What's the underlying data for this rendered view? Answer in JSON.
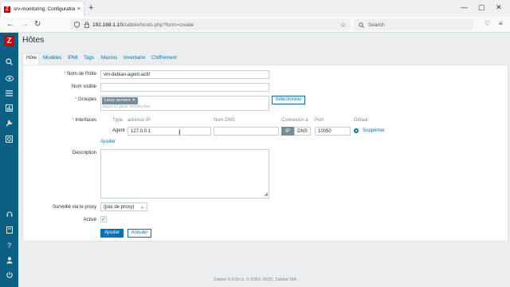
{
  "browser": {
    "tab_title": "srv-monitoring: Configuration",
    "tab_close": "×",
    "new_tab": "+",
    "url_host": "192.168.1.10",
    "url_path": "/zabbix/hosts.php?form=create",
    "search_placeholder": "Search",
    "window_controls": [
      "—",
      "▢",
      "✕"
    ]
  },
  "sidebar": {
    "logo": "Z",
    "icons": [
      "search-icon",
      "monitoring-eye-icon",
      "inventory-list-icon",
      "reports-chart-icon",
      "configuration-wrench-icon",
      "administration-icon",
      "support-icon",
      "share-icon",
      "help-icon",
      "user-icon",
      "logout-icon"
    ]
  },
  "page": {
    "title": "Hôtes",
    "tabs": [
      "Hôte",
      "Modèles",
      "IPMI",
      "Tags",
      "Macros",
      "Inventaire",
      "Chiffrement"
    ],
    "active_tab": 0
  },
  "form": {
    "required_mark": "*",
    "hostname_label": "Nom de l'hôte",
    "hostname_value": "vm-debian-agent-actif",
    "visible_name_label": "Nom visible",
    "visible_name_value": "",
    "groups_label": "Groupes",
    "groups_tag": "Linux servers",
    "groups_tag_remove": "✕",
    "groups_placeholder": "taper ici pour rechercher",
    "groups_select_button": "Sélectionner",
    "interfaces_label": "Interfaces",
    "interfaces_headers": {
      "type": "Type",
      "ip": "adresse IP",
      "dns": "Nom DNS",
      "connect": "Connexion à",
      "port": "Port",
      "default": "Défaut"
    },
    "interface_row": {
      "type": "Agent",
      "ip": "127.0.0.1",
      "dns": "",
      "connect_ip": "IP",
      "connect_dns": "DNS",
      "connect_selected": "IP",
      "port": "10050",
      "remove": "Supprimer"
    },
    "add_interface_link": "Ajouter",
    "description_label": "Description",
    "description_value": "",
    "proxy_label": "Surveillé via le proxy",
    "proxy_value": "(pas de proxy)",
    "enabled_label": "Activé",
    "enabled_checked": true,
    "check_mark": "✓",
    "add_button": "Ajouter",
    "cancel_button": "Annuler"
  },
  "footer": {
    "text": "Zabbix 5.0.0rc1. © 2001–2020, Zabbix SIA"
  }
}
